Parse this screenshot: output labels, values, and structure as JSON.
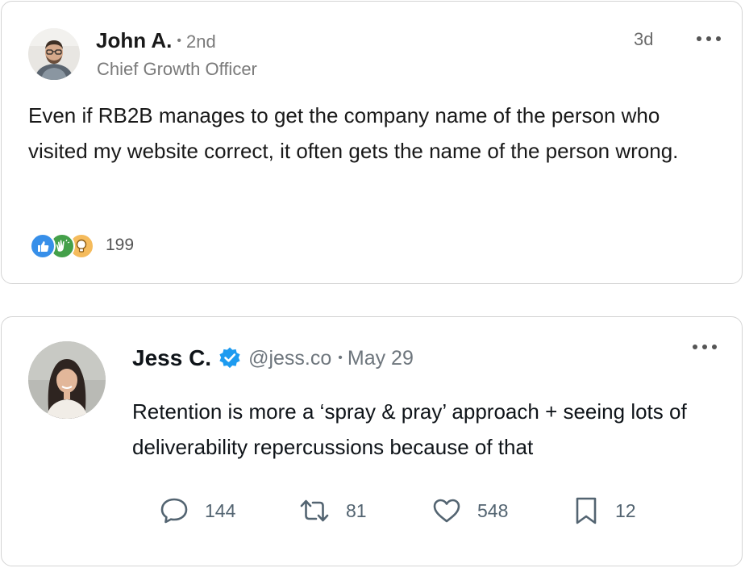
{
  "linkedin_post": {
    "author": "John A.",
    "degree": "2nd",
    "title": "Chief Growth Officer",
    "time": "3d",
    "text": "Even if RB2B manages to get the company name of the person who visited my website correct, it often gets the name of the person wrong.",
    "reactions": [
      "like-icon",
      "clap-icon",
      "insightful-icon"
    ],
    "reaction_count": "199"
  },
  "tweet": {
    "author": "Jess C.",
    "handle": "@jess.co",
    "date": "May 29",
    "text": "Retention is more a ‘spray & pray’ approach + seeing lots of deliverability repercussions because of that",
    "replies": "144",
    "retweets": "81",
    "likes": "548",
    "bookmarks": "12"
  },
  "colors": {
    "verified_badge": "#1d9bf0",
    "like_reaction": "#378fe9",
    "clap_reaction": "#44a04a",
    "insight_reaction": "#f5bb5c"
  }
}
